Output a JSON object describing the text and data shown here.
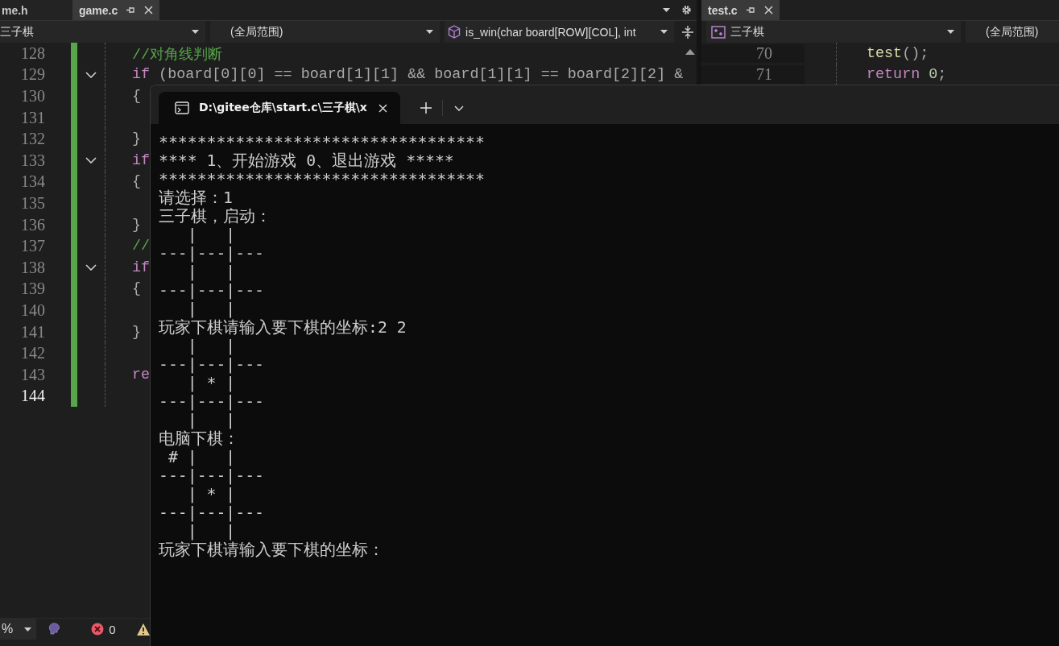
{
  "left_editor": {
    "tabs": [
      {
        "label": "me.h",
        "selected": false
      },
      {
        "label": "game.c",
        "selected": true
      }
    ],
    "nav": {
      "project": "三子棋",
      "scope": "(全局范围)",
      "member": "is_win(char board[ROW][COL], int"
    },
    "lines": [
      {
        "number": "128",
        "changed": true,
        "collapsible": false,
        "current": false,
        "tokens": [
          {
            "kind": "comment",
            "text": "//对角线判断"
          }
        ]
      },
      {
        "number": "129",
        "changed": true,
        "collapsible": true,
        "current": false,
        "tokens": [
          {
            "kind": "keyword",
            "text": "if"
          },
          {
            "kind": "plain",
            "text": " (board[0][0] == board[1][1] && board[1][1] == board[2][2] &"
          }
        ]
      },
      {
        "number": "130",
        "changed": true,
        "collapsible": false,
        "current": false,
        "tokens": [
          {
            "kind": "plain",
            "text": "{"
          }
        ]
      },
      {
        "number": "131",
        "changed": true,
        "collapsible": false,
        "current": false
      },
      {
        "number": "132",
        "changed": true,
        "collapsible": false,
        "current": false,
        "tokens": [
          {
            "kind": "plain",
            "text": "}"
          }
        ]
      },
      {
        "number": "133",
        "changed": true,
        "collapsible": true,
        "current": false,
        "tokens": [
          {
            "kind": "keyword",
            "text": "if"
          }
        ]
      },
      {
        "number": "134",
        "changed": true,
        "collapsible": false,
        "current": false,
        "tokens": [
          {
            "kind": "plain",
            "text": "{"
          }
        ]
      },
      {
        "number": "135",
        "changed": true,
        "collapsible": false,
        "current": false
      },
      {
        "number": "136",
        "changed": true,
        "collapsible": false,
        "current": false,
        "tokens": [
          {
            "kind": "plain",
            "text": "}"
          }
        ]
      },
      {
        "number": "137",
        "changed": true,
        "collapsible": false,
        "current": false,
        "tokens": [
          {
            "kind": "comment",
            "text": "//"
          }
        ]
      },
      {
        "number": "138",
        "changed": true,
        "collapsible": true,
        "current": false,
        "tokens": [
          {
            "kind": "keyword",
            "text": "if"
          }
        ]
      },
      {
        "number": "139",
        "changed": true,
        "collapsible": false,
        "current": false,
        "tokens": [
          {
            "kind": "plain",
            "text": "{"
          }
        ]
      },
      {
        "number": "140",
        "changed": true,
        "collapsible": false,
        "current": false
      },
      {
        "number": "141",
        "changed": true,
        "collapsible": false,
        "current": false,
        "tokens": [
          {
            "kind": "plain",
            "text": "}"
          }
        ]
      },
      {
        "number": "142",
        "changed": true,
        "collapsible": false,
        "current": false
      },
      {
        "number": "143",
        "changed": true,
        "collapsible": false,
        "current": false,
        "tokens": [
          {
            "kind": "keyword",
            "text": "re"
          }
        ]
      },
      {
        "number": "144",
        "changed": true,
        "collapsible": false,
        "current": true
      }
    ]
  },
  "right_editor": {
    "tabs": [
      {
        "label": "test.c",
        "selected": true
      }
    ],
    "nav": {
      "project": "三子棋",
      "scope": "(全局范围)"
    },
    "lines": [
      {
        "number": "70",
        "changed": false,
        "collapsible": false,
        "current": false,
        "tokens": [
          {
            "kind": "function",
            "text": "test"
          },
          {
            "kind": "plain",
            "text": "();"
          }
        ]
      },
      {
        "number": "71",
        "changed": false,
        "collapsible": false,
        "current": false,
        "tokens": [
          {
            "kind": "keyword",
            "text": "return "
          },
          {
            "kind": "number",
            "text": "0"
          },
          {
            "kind": "plain",
            "text": ";"
          }
        ]
      }
    ]
  },
  "status_bar": {
    "zoom": "%",
    "errors": "0"
  },
  "terminal": {
    "tab_title": "D:\\gitee仓库\\start.c\\三子棋\\x",
    "output_lines": [
      "**********************************",
      "**** 1、开始游戏 0、退出游戏 *****",
      "**********************************",
      "请选择：1",
      "三子棋，启动：",
      "   |   |",
      "---|---|---",
      "   |   |",
      "---|---|---",
      "   |   |",
      "玩家下棋请输入要下棋的坐标:2 2",
      "   |   |",
      "---|---|---",
      "   | * |",
      "---|---|---",
      "   |   |",
      "电脑下棋：",
      " # |   |",
      "---|---|---",
      "   | * |",
      "---|---|---",
      "   |   |",
      "玩家下棋请输入要下棋的坐标："
    ]
  }
}
